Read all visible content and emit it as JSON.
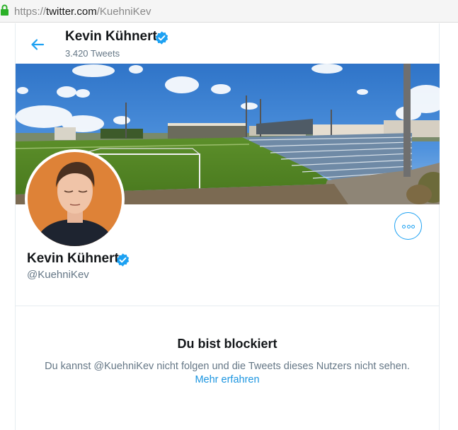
{
  "browser": {
    "url_scheme": "https://",
    "url_host": "twitter.com",
    "url_path": "/KuehniKev"
  },
  "header": {
    "name": "Kevin Kühnert",
    "tweet_count": "3.420 Tweets",
    "back_icon": "arrow-left-icon"
  },
  "profile": {
    "name": "Kevin Kühnert",
    "handle": "@KuehniKev",
    "verified_icon": "verified-badge-icon",
    "more_icon": "more-options-icon"
  },
  "blocked": {
    "title": "Du bist blockiert",
    "message": "Du kannst @KuehniKev nicht folgen und die Tweets dieses Nutzers nicht sehen.",
    "learn_more": "Mehr erfahren"
  },
  "colors": {
    "accent": "#1da1f2",
    "link": "#1b95e0",
    "text_primary": "#14171a",
    "text_secondary": "#657786",
    "secure_lock": "#2ab027"
  }
}
